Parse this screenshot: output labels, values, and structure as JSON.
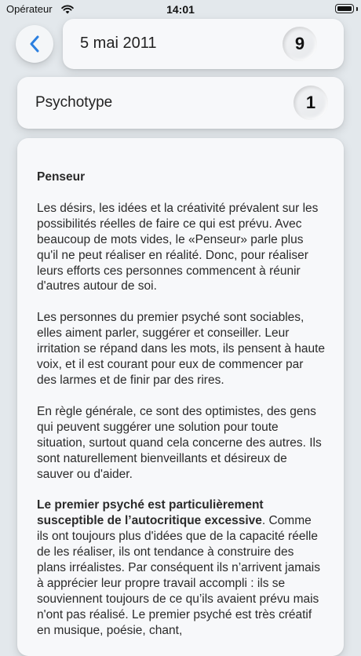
{
  "status": {
    "carrier": "Opérateur",
    "time": "14:01"
  },
  "header": {
    "date": "5 mai 2011",
    "date_number": "9"
  },
  "psychotype": {
    "label": "Psychotype",
    "number": "1"
  },
  "content": {
    "title": "Penseur",
    "paragraphs": [
      "Les désirs, les idées et la créativité prévalent sur les possibilités réelles de faire ce qui est prévu. Avec beaucoup de mots vides, le «Penseur» parle plus qu'il ne peut réaliser en réalité. Donc, pour réaliser leurs efforts ces personnes commencent à réunir d'autres autour de soi.",
      "Les personnes du premier psyché sont sociables, elles aiment parler, suggérer et conseiller. Leur irritation se répand dans les mots, ils pensent à haute voix, et il est courant pour eux de commencer par des larmes et de finir par des rires.",
      "En règle générale, ce sont des optimistes, des gens qui peuvent suggérer une solution pour toute situation, surtout quand cela concerne des autres. Ils sont naturellement bienveillants et désireux de sauver ou d'aider."
    ],
    "last_bold": "Le premier psyché est particulièrement susceptible de l’autocritique excessive",
    "last_rest": ". Comme ils ont toujours plus d'idées que de la capacité réelle de les réaliser, ils ont tendance à construire des plans irréalistes. Par conséquent ils n’arrivent jamais à apprécier leur propre travail accompli : ils se souviennent toujours de ce qu’ils avaient prévu mais n'ont pas réalisé. Le premier psyché est très créatif en musique, poésie, chant,"
  }
}
